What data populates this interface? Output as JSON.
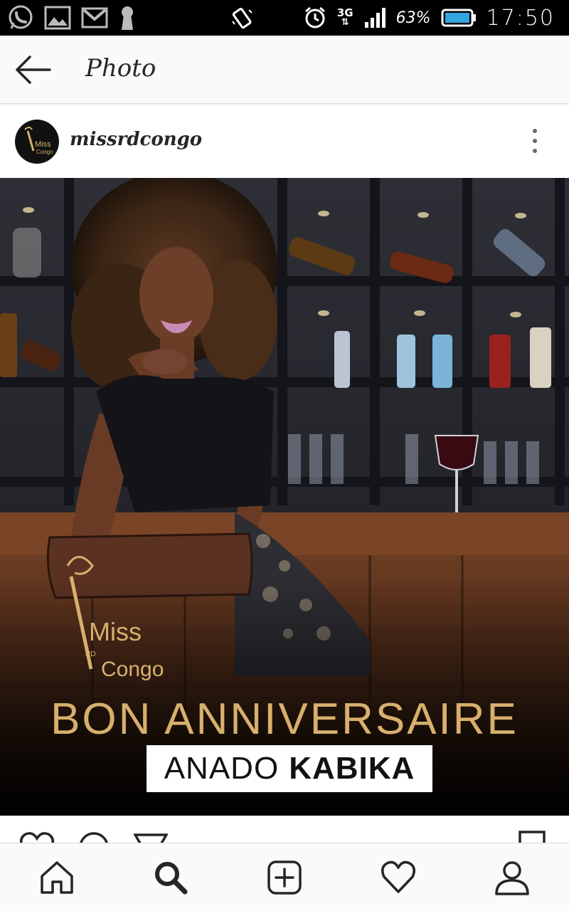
{
  "status_bar": {
    "network": "3G",
    "battery_percent": "63%",
    "time": "17:50",
    "icons": [
      "whatsapp-icon",
      "gallery-icon",
      "gmail-icon",
      "keyhole-icon",
      "vibrate-icon",
      "alarm-icon",
      "signal-icon",
      "battery-icon"
    ]
  },
  "app_bar": {
    "title": "Photo",
    "back_icon": "arrow-left-icon"
  },
  "post": {
    "username": "missrdcongo",
    "more_icon": "more-vertical-icon",
    "image": {
      "title": "BON ANNIVERSAIRE",
      "name_first": "ANADO",
      "name_last": "KABIKA"
    },
    "actions": [
      "heart-icon",
      "comment-icon",
      "share-icon",
      "bookmark-icon"
    ]
  },
  "bottom_nav": {
    "items": [
      "home-icon",
      "search-icon",
      "add-icon",
      "activity-heart-icon",
      "profile-icon"
    ],
    "active": "search-icon"
  },
  "colors": {
    "status_bar_bg": "#000000",
    "app_bg": "#fafafa",
    "gold": "#d7b06d",
    "text": "#262626"
  }
}
